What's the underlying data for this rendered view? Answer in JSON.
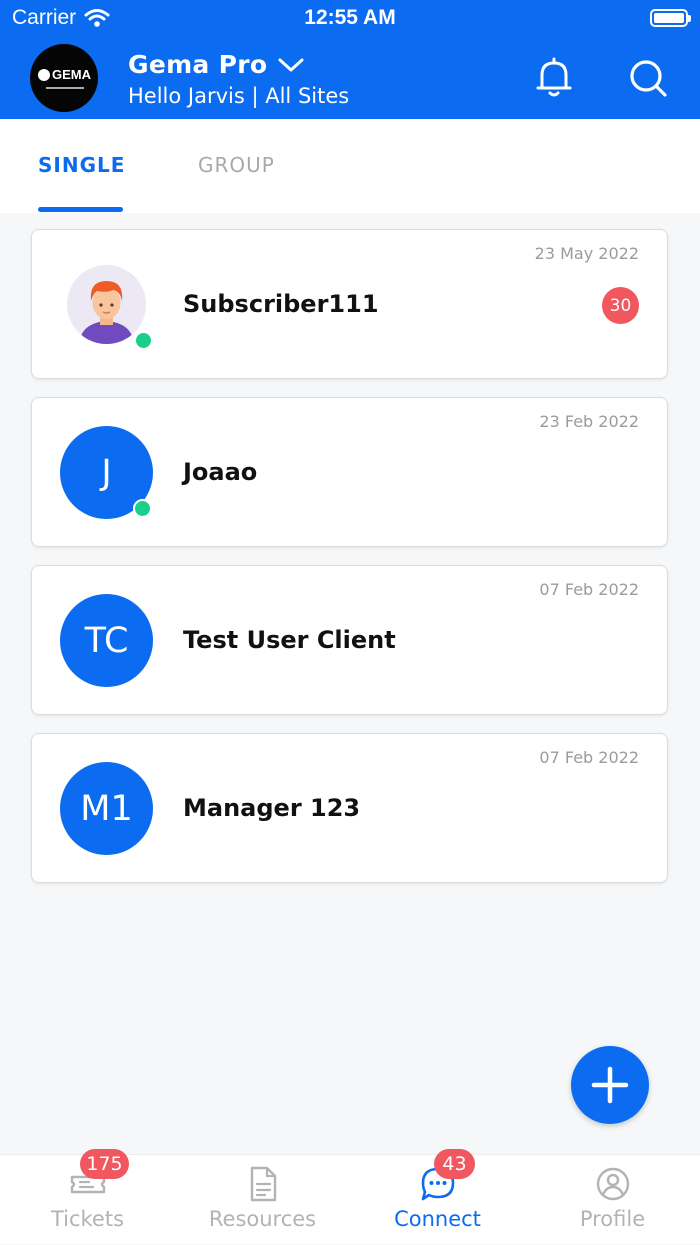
{
  "status_bar": {
    "carrier": "Carrier",
    "time": "12:55 AM"
  },
  "header": {
    "logo_text": "GEMA",
    "app_title": "Gema Pro",
    "subtitle": "Hello Jarvis | All Sites",
    "icons": [
      "bell-icon",
      "search-icon"
    ]
  },
  "tabs": {
    "single": "SINGLE",
    "group": "GROUP",
    "active": "single"
  },
  "conversations": [
    {
      "name": "Subscriber111",
      "date": "23 May 2022",
      "avatar_type": "photo",
      "online": true,
      "unread": "30"
    },
    {
      "name": "Joaao",
      "date": "23 Feb 2022",
      "avatar_type": "initials",
      "initials": "J",
      "online": true
    },
    {
      "name": "Test User Client",
      "date": "07 Feb 2022",
      "avatar_type": "initials",
      "initials": "TC",
      "online": false
    },
    {
      "name": "Manager 123",
      "date": "07 Feb 2022",
      "avatar_type": "initials",
      "initials": "M1",
      "online": false
    }
  ],
  "fab": {
    "icon": "plus-icon"
  },
  "bottom_nav": {
    "items": [
      {
        "label": "Tickets",
        "icon": "ticket-icon",
        "badge": "175"
      },
      {
        "label": "Resources",
        "icon": "document-icon"
      },
      {
        "label": "Connect",
        "icon": "chat-icon",
        "badge": "43",
        "active": true
      },
      {
        "label": "Profile",
        "icon": "profile-icon"
      }
    ]
  },
  "colors": {
    "primary": "#0b6cf2",
    "online": "#19cf8b",
    "badge": "#f0575e",
    "inactive": "#b3b3b3"
  }
}
